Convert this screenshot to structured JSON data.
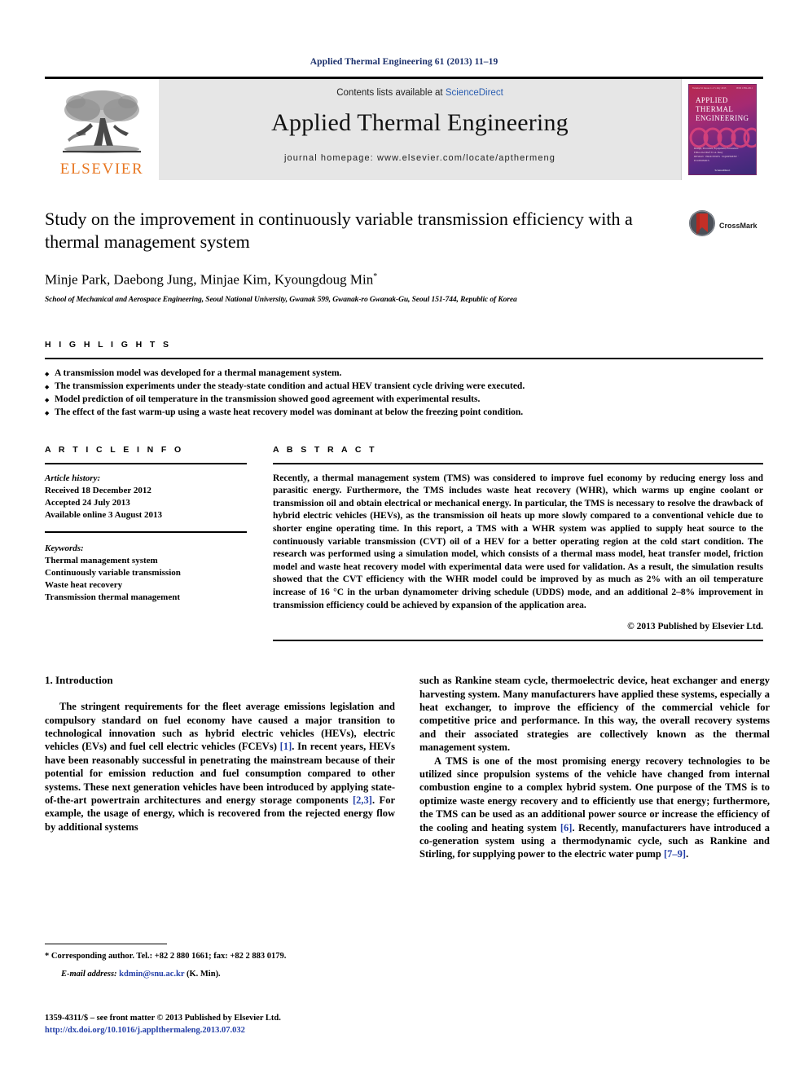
{
  "running_head": "Applied Thermal Engineering 61 (2013) 11–19",
  "masthead": {
    "publisher_name": "ELSEVIER",
    "contents_prefix": "Contents lists available at ",
    "contents_link": "ScienceDirect",
    "journal_title": "Applied Thermal Engineering",
    "homepage": "journal homepage: www.elsevier.com/locate/apthermeng",
    "cover": {
      "volume_line": "Volume 61  Issues 1-2  5 July 2013",
      "issn_line": "ISSN 1359-4311",
      "title_line_1": "APPLIED",
      "title_line_2": "THERMAL",
      "title_line_3": "ENGINEERING",
      "subtitle": "Design, Processes, Equipment, Economics",
      "editors": "Editor-in-Chief: D. A. Reay",
      "footer_names": "DESIGN · PROCESSES · EQUIPMENT · ECONOMICS",
      "publisher": "ScienceDirect"
    }
  },
  "article": {
    "title": "Study on the improvement in continuously variable transmission efficiency with a thermal management system",
    "authors": "Minje Park, Daebong Jung, Minjae Kim, Kyoungdoug Min",
    "author_marker": "*",
    "affiliation": "School of Mechanical and Aerospace Engineering, Seoul National University, Gwanak 599, Gwanak-ro Gwanak-Gu, Seoul 151-744, Republic of Korea",
    "crossmark_label": "CrossMark"
  },
  "highlights": {
    "heading": "H I G H L I G H T S",
    "items": [
      "A transmission model was developed for a thermal management system.",
      "The transmission experiments under the steady-state condition and actual HEV transient cycle driving were executed.",
      "Model prediction of oil temperature in the transmission showed good agreement with experimental results.",
      "The effect of the fast warm-up using a waste heat recovery model was dominant at below the freezing point condition."
    ]
  },
  "article_info": {
    "heading": "A R T I C L E   I N F O",
    "history_title": "Article history:",
    "history": [
      "Received 18 December 2012",
      "Accepted 24 July 2013",
      "Available online 3 August 2013"
    ],
    "keywords_title": "Keywords:",
    "keywords": [
      "Thermal management system",
      "Continuously variable transmission",
      "Waste heat recovery",
      "Transmission thermal management"
    ]
  },
  "abstract": {
    "heading": "A B S T R A C T",
    "text": "Recently, a thermal management system (TMS) was considered to improve fuel economy by reducing energy loss and parasitic energy. Furthermore, the TMS includes waste heat recovery (WHR), which warms up engine coolant or transmission oil and obtain electrical or mechanical energy. In particular, the TMS is necessary to resolve the drawback of hybrid electric vehicles (HEVs), as the transmission oil heats up more slowly compared to a conventional vehicle due to shorter engine operating time. In this report, a TMS with a WHR system was applied to supply heat source to the continuously variable transmission (CVT) oil of a HEV for a better operating region at the cold start condition. The research was performed using a simulation model, which consists of a thermal mass model, heat transfer model, friction model and waste heat recovery model with experimental data were used for validation. As a result, the simulation results showed that the CVT efficiency with the WHR model could be improved by as much as 2% with an oil temperature increase of 16 °C in the urban dynamometer driving schedule (UDDS) mode, and an additional 2–8% improvement in transmission efficiency could be achieved by expansion of the application area.",
    "copyright": "© 2013 Published by Elsevier Ltd."
  },
  "body": {
    "section_number_title": "1.  Introduction",
    "left_paragraph_1": "The stringent requirements for the fleet average emissions legislation and compulsory standard on fuel economy have caused a major transition to technological innovation such as hybrid electric vehicles (HEVs), electric vehicles (EVs) and fuel cell electric vehicles (FCEVs) ",
    "ref_1": "[1]",
    "left_paragraph_1b": ". In recent years, HEVs have been reasonably successful in penetrating the mainstream because of their potential for emission reduction and fuel consumption compared to other systems. These next generation vehicles have been introduced by applying state-of-the-art powertrain architectures and energy storage components ",
    "ref_23": "[2,3]",
    "left_paragraph_1c": ". For example, the usage of energy, which is recovered from the rejected energy flow by additional systems",
    "right_paragraph_1": "such as Rankine steam cycle, thermoelectric device, heat exchanger and energy harvesting system. Many manufacturers have applied these systems, especially a heat exchanger, to improve the efficiency of the commercial vehicle for competitive price and performance. In this way, the overall recovery systems and their associated strategies are collectively known as the thermal management system.",
    "right_paragraph_2a": "A TMS is one of the most promising energy recovery technologies to be utilized since propulsion systems of the vehicle have changed from internal combustion engine to a complex hybrid system. One purpose of the TMS is to optimize waste energy recovery and to efficiently use that energy; furthermore, the TMS can be used as an additional power source or increase the efficiency of the cooling and heating system ",
    "ref_6": "[6]",
    "right_paragraph_2b": ". Recently, manufacturers have introduced a co-generation system using a thermodynamic cycle, such as Rankine and Stirling, for supplying power to the electric water pump ",
    "ref_79": "[7–9]",
    "right_paragraph_2c": "."
  },
  "footnotes": {
    "corresponding_marker": "*",
    "corresponding_text": "Corresponding author. Tel.: +82 2 880 1661; fax: +82 2 883 0179.",
    "email_label": "E-mail address:",
    "email": "kdmin@snu.ac.kr",
    "email_suffix": "(K. Min)."
  },
  "imprint": {
    "issn_line": "1359-4311/$ – see front matter © 2013 Published by Elsevier Ltd.",
    "doi": "http://dx.doi.org/10.1016/j.applthermaleng.2013.07.032"
  },
  "colors": {
    "link": "#2540a8",
    "running_head": "#1a2f6b",
    "elsevier_orange": "#E87722",
    "sciencedirect": "#2a5db0",
    "banner_bg": "#e6e6e6"
  }
}
